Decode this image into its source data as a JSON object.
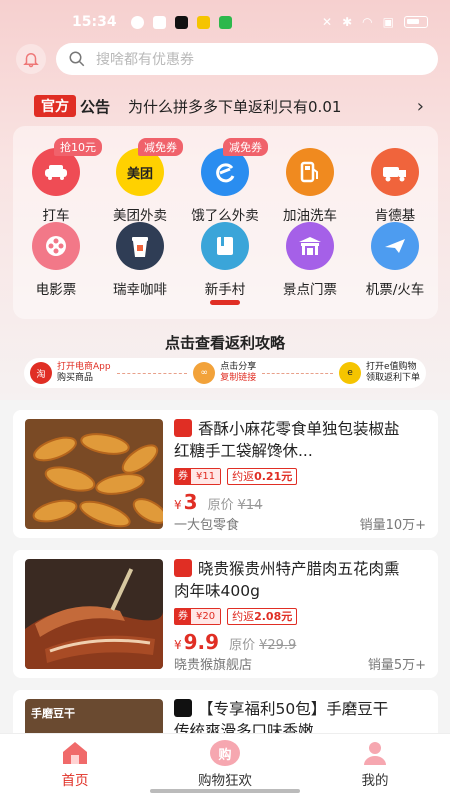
{
  "status_bar": {
    "time": "15:34"
  },
  "search": {
    "placeholder": "搜啥都有优惠券"
  },
  "notice": {
    "tag": "官方",
    "label": "公告",
    "text": "为什么拼多多下单返利只有0.01"
  },
  "grid": [
    {
      "label": "打车",
      "badge": "抢10元",
      "icon": "car-icon",
      "color": "#ef4c55"
    },
    {
      "label": "美团外卖",
      "badge": "减免券",
      "icon": "meituan-icon",
      "color": "#ffd100",
      "icon_text": "美团"
    },
    {
      "label": "饿了么外卖",
      "badge": "减免券",
      "icon": "eleme-icon",
      "color": "#2a8df0"
    },
    {
      "label": "加油洗车",
      "badge": "",
      "icon": "fuel-icon",
      "color": "#f08a1f"
    },
    {
      "label": "肯德基",
      "badge": "",
      "icon": "kfc-icon",
      "color": "#f0643c"
    },
    {
      "label": "电影票",
      "badge": "",
      "icon": "film-icon",
      "color": "#f27888"
    },
    {
      "label": "瑞幸咖啡",
      "badge": "",
      "icon": "coffee-icon",
      "color": "#2f3d55"
    },
    {
      "label": "新手村",
      "badge": "",
      "icon": "book-icon",
      "color": "#3aa5d9"
    },
    {
      "label": "景点门票",
      "badge": "",
      "icon": "attraction-icon",
      "color": "#a560e8"
    },
    {
      "label": "机票/火车",
      "badge": "",
      "icon": "plane-icon",
      "color": "#4d9cf0"
    }
  ],
  "guide": {
    "title": "点击查看返利攻略",
    "steps": [
      {
        "line1": "打开电商App",
        "line2": "购买商品",
        "icon": "shop-app-icon"
      },
      {
        "line1": "点击分享",
        "line2": "复制链接",
        "icon": "link-icon"
      },
      {
        "line1": "打开e值购物",
        "line2": "领取返利下单",
        "icon": "evalue-app-icon"
      }
    ]
  },
  "products": [
    {
      "title": "香酥小麻花零食单独包装椒盐红糖手工袋解馋休...",
      "coupon_label": "券",
      "coupon_value": "¥11",
      "rebate_label": "约返",
      "rebate_value": "0.21元",
      "currency": "¥",
      "price": "3",
      "original_label": "原价",
      "original_price": "¥14",
      "shop": "一大包零食",
      "sales": "销量10万+",
      "source_color": "#e02e24"
    },
    {
      "title": "晓贵猴贵州特产腊肉五花肉熏肉年味400g",
      "coupon_label": "券",
      "coupon_value": "¥20",
      "rebate_label": "约返",
      "rebate_value": "2.08元",
      "currency": "¥",
      "price": "9.9",
      "original_label": "原价",
      "original_price": "¥29.9",
      "shop": "晓贵猴旗舰店",
      "sales": "销量5万+",
      "source_color": "#e02e24"
    },
    {
      "title": "【专享福利50包】手磨豆干传统爽滑多口味香嫩...",
      "image_caption": "手磨豆干",
      "source_color": "#111111"
    }
  ],
  "bottom_nav": [
    {
      "label": "首页",
      "icon": "home-icon",
      "active": true
    },
    {
      "label": "购物狂欢",
      "icon": "shopping-icon",
      "icon_text": "购",
      "active": false
    },
    {
      "label": "我的",
      "icon": "profile-icon",
      "active": false
    }
  ]
}
